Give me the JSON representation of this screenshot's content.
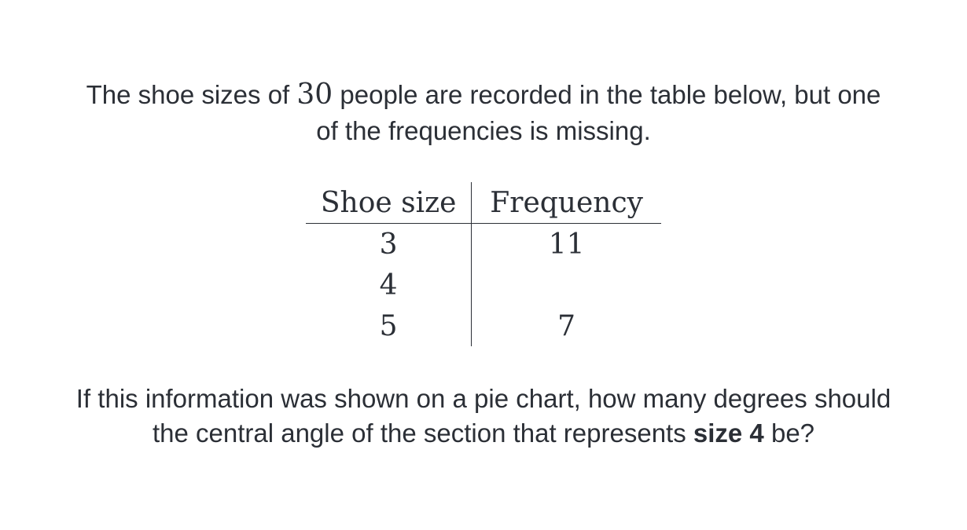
{
  "intro": {
    "before_number": "The shoe sizes of ",
    "number": "30",
    "after_number": " people are recorded in the table below, but one",
    "line2": "of the frequencies is missing."
  },
  "table": {
    "headers": [
      "Shoe size",
      "Frequency"
    ],
    "rows": [
      {
        "size": "3",
        "frequency": "11"
      },
      {
        "size": "4",
        "frequency": ""
      },
      {
        "size": "5",
        "frequency": "7"
      }
    ]
  },
  "prompt": {
    "line1": "If this information was shown on a pie chart, how many degrees should",
    "line2_before": "the central angle of the section that represents ",
    "line2_bold": "size 4",
    "line2_after": " be?"
  }
}
